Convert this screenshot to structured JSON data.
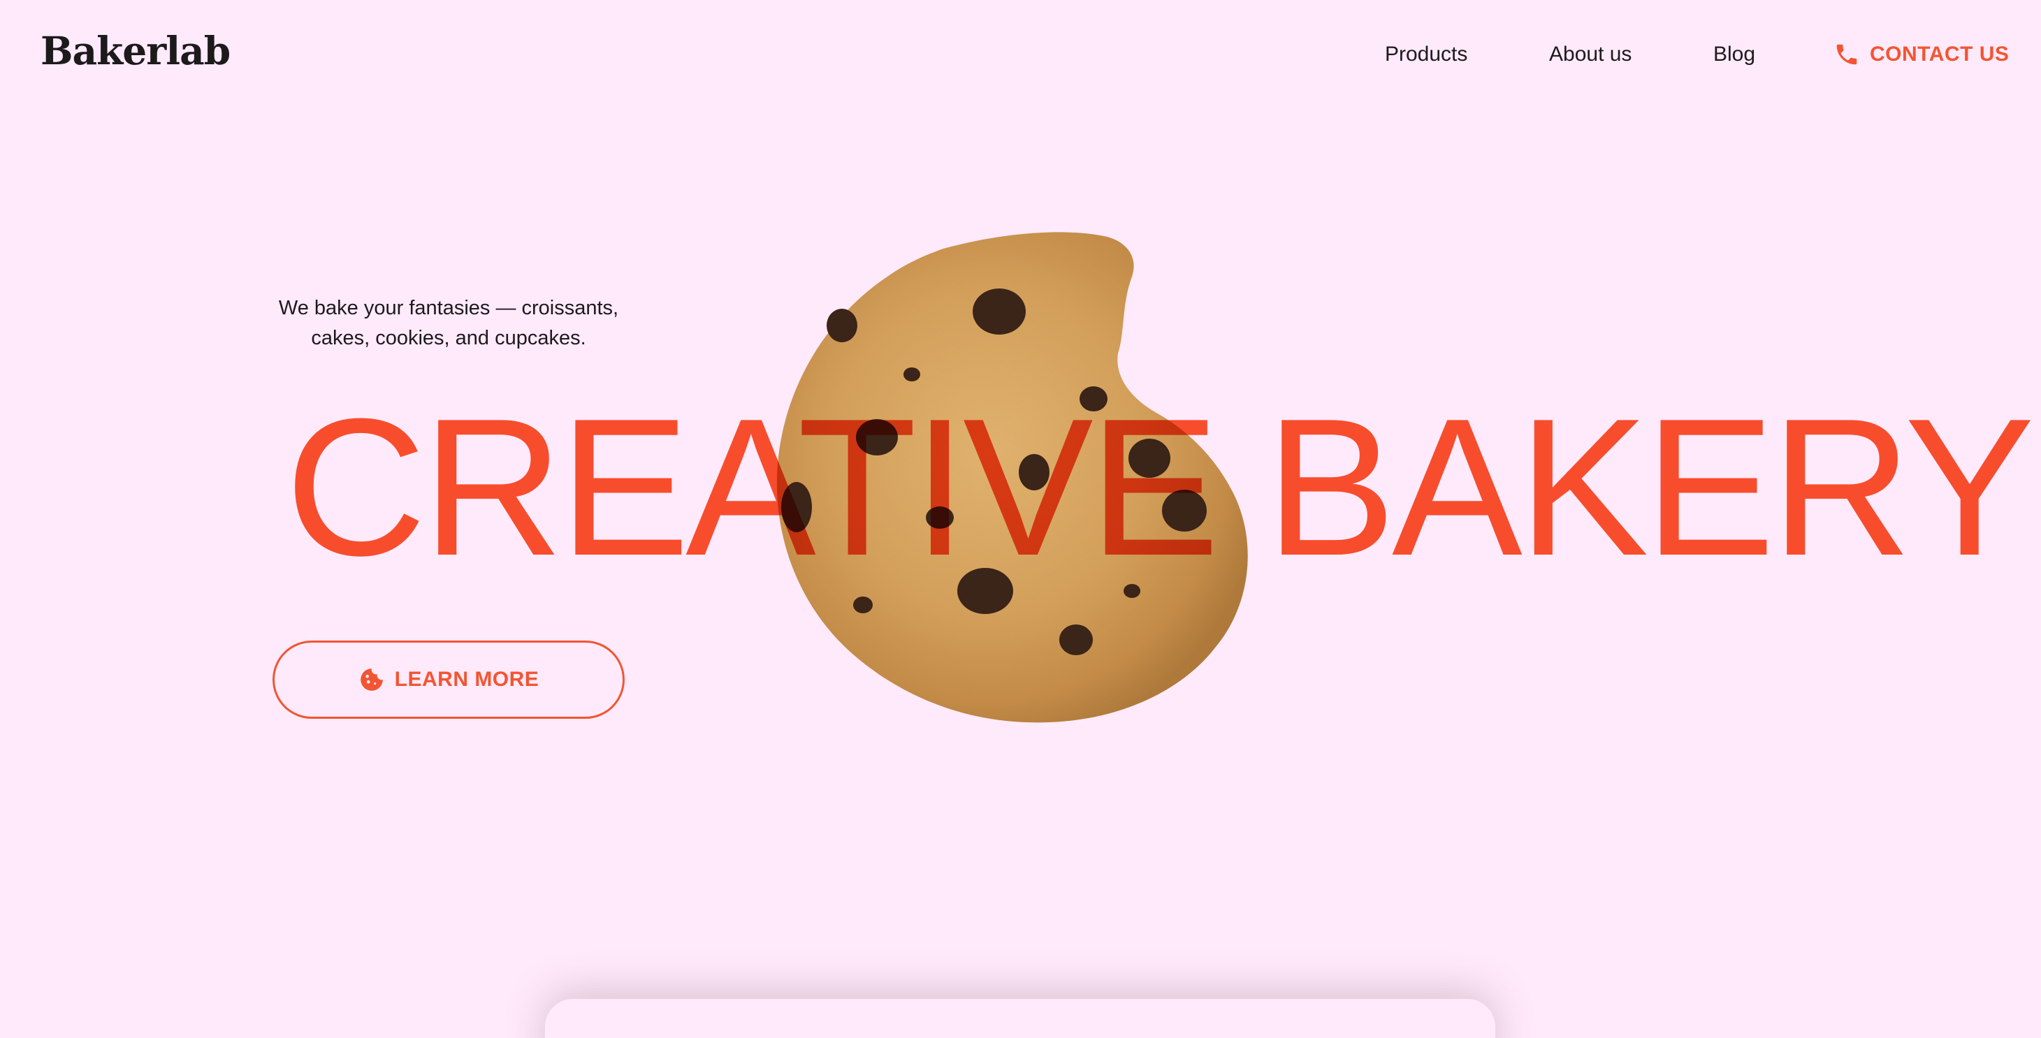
{
  "brand": {
    "logo_text": "Bakerlab"
  },
  "nav": {
    "items": [
      {
        "label": "Products"
      },
      {
        "label": "About us"
      },
      {
        "label": "Blog"
      }
    ],
    "contact_label": "CONTACT US"
  },
  "hero": {
    "tagline_line1": "We bake your fantasies — croissants,",
    "tagline_line2": "cakes, cookies, and cupcakes.",
    "headline": "CREATIVE BAKERY",
    "cta_label": "LEARN MORE",
    "image": "chocolate-chip-cookie-bitten"
  },
  "colors": {
    "background": "#ffeafb",
    "accent": "#f25531",
    "text": "#1d1a1c"
  },
  "icons": {
    "contact": "phone-icon",
    "cta": "cookie-icon"
  }
}
